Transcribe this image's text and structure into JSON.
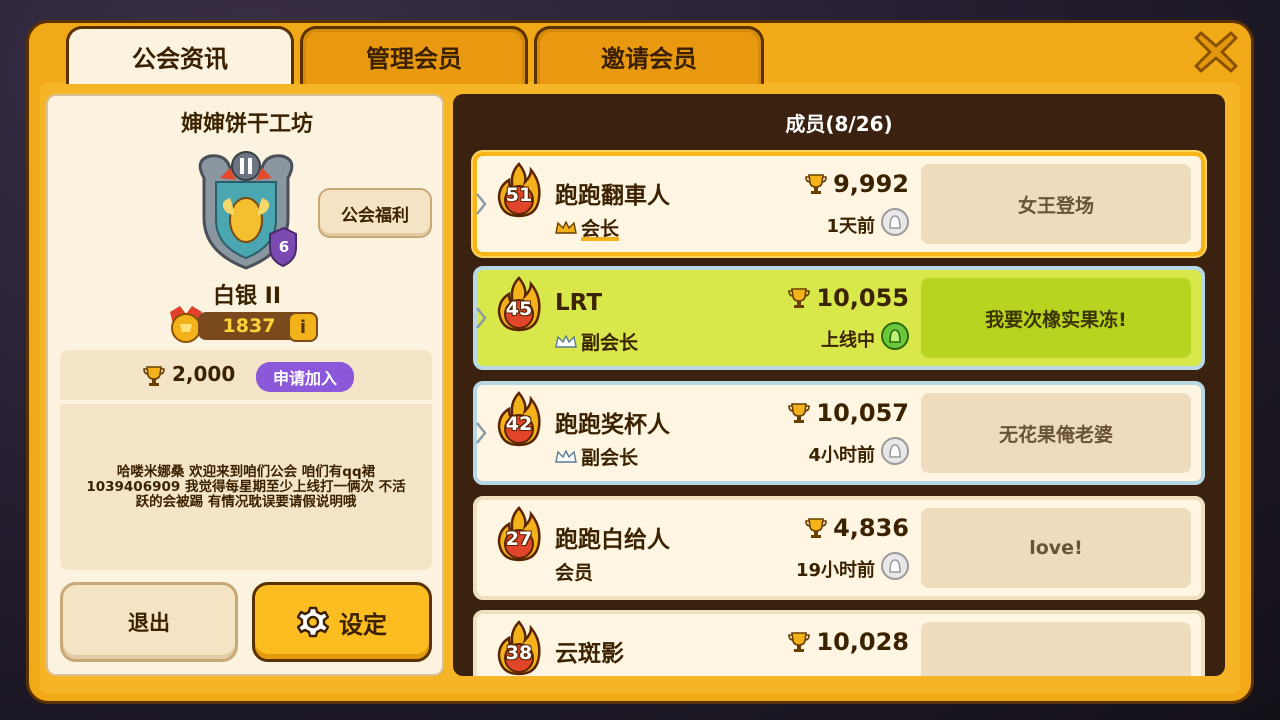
{
  "tabs": [
    {
      "label": "公会资讯",
      "active": true
    },
    {
      "label": "管理会员",
      "active": false
    },
    {
      "label": "邀请会员",
      "active": false
    }
  ],
  "guild": {
    "name": "婶婶饼干工坊",
    "emblem_level": "6",
    "emblem_tier": "II",
    "rank": "白银 II",
    "score": "1837",
    "benefit_label": "公会福利",
    "requirement_trophies": "2,000",
    "apply_label": "申请加入",
    "description": "哈喽米娜桑 欢迎来到咱们公会 咱们有qq裙1039406909 我觉得每星期至少上线打一俩次 不活跃的会被踢 有情况耽误要请假说明哦",
    "quit_label": "退出",
    "settings_label": "设定"
  },
  "members_header": "成员(8/26)",
  "members": [
    {
      "level": "51",
      "name": "跑跑翻車人",
      "role": "会长",
      "trophies": "9,992",
      "last_seen": "1天前",
      "message": "女王登场",
      "status": "leader"
    },
    {
      "level": "45",
      "name": "LRT",
      "role": "副会长",
      "trophies": "10,055",
      "last_seen": "上线中",
      "message": "我要次橡实果冻!",
      "status": "online"
    },
    {
      "level": "42",
      "name": "跑跑奖杯人",
      "role": "副会长",
      "trophies": "10,057",
      "last_seen": "4小时前",
      "message": "无花果俺老婆",
      "status": "vice"
    },
    {
      "level": "27",
      "name": "跑跑白给人",
      "role": "会员",
      "trophies": "4,836",
      "last_seen": "19小时前",
      "message": "love!",
      "status": "normal"
    },
    {
      "level": "38",
      "name": "云斑影",
      "role": "",
      "trophies": "10,028",
      "last_seen": "",
      "message": "❤❤",
      "status": "normal"
    }
  ],
  "colors": {
    "frame": "#f2a918",
    "panel_dark": "#3a2110",
    "online_green": "#d8e84a",
    "leader_gold": "#f8b61a",
    "apply_purple": "#8a58d8"
  }
}
